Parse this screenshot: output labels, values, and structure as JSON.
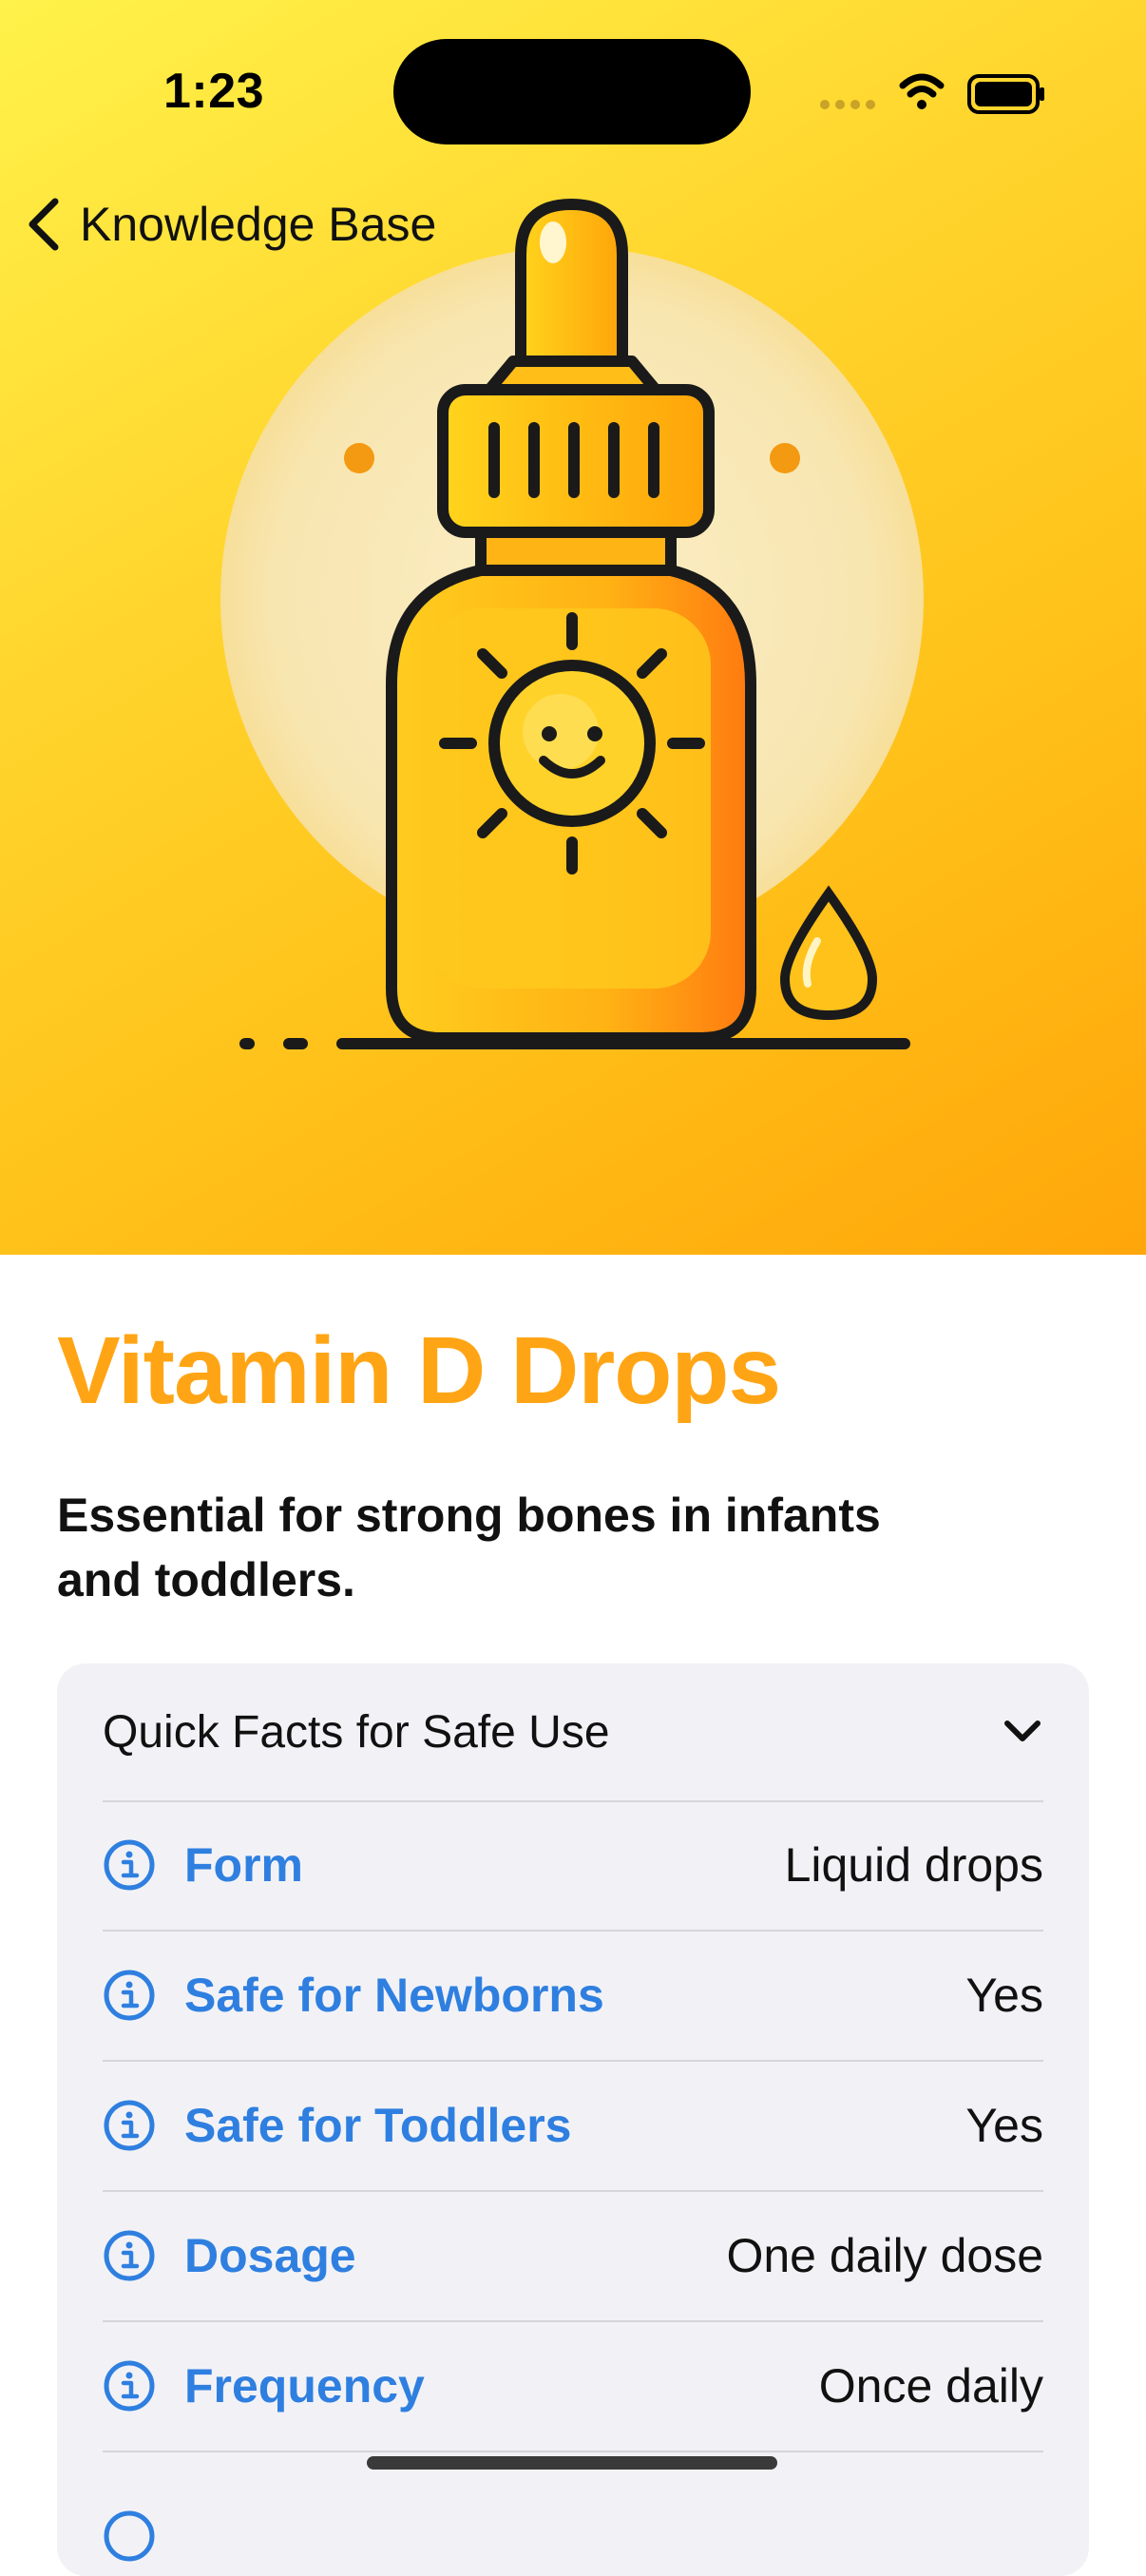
{
  "status_bar": {
    "time": "1:23"
  },
  "nav": {
    "back_label": "Knowledge Base"
  },
  "article": {
    "title": "Vitamin D Drops",
    "subtitle": "Essential for strong bones in infants and toddlers."
  },
  "quick_facts": {
    "title": "Quick Facts for Safe Use",
    "expanded": true,
    "rows": [
      {
        "label": "Form",
        "value": "Liquid drops"
      },
      {
        "label": "Safe for Newborns",
        "value": "Yes"
      },
      {
        "label": "Safe for Toddlers",
        "value": "Yes"
      },
      {
        "label": "Dosage",
        "value": "One daily dose"
      },
      {
        "label": "Frequency",
        "value": "Once daily"
      }
    ]
  },
  "colors": {
    "title_accent": "#ffa515",
    "link_blue": "#2f7fe0",
    "hero_top": "#fff24a",
    "hero_bottom": "#ffa60a",
    "card_bg": "#f2f2f6"
  },
  "icons": [
    "chevron-left-icon",
    "wifi-icon",
    "battery-icon",
    "cellular-icon",
    "chevron-down-icon",
    "info-circle-icon",
    "vitamin-d-bottle-illustration"
  ]
}
